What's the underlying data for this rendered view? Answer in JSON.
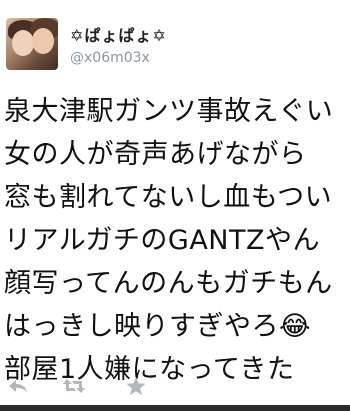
{
  "user": {
    "display_name": "✡ぱょぱょ✡",
    "handle": "@x06m03x"
  },
  "tweet": {
    "lines": [
      "泉大津駅ガンツ事故えぐい",
      "女の人が奇声あげながら",
      "窓も割れてないし血もつい",
      "リアルガチのGANTZやん",
      "顔写ってんのんもガチもん",
      "はっきし映りすぎやろ😂",
      "部屋1人嫌になってきた"
    ]
  },
  "actions": {
    "reply_icon": "reply-icon",
    "retweet_icon": "retweet-icon",
    "favorite_icon": "star-icon"
  },
  "colors": {
    "handle": "#8899a6",
    "action_icon": "#b0b8c0",
    "text": "#111111"
  }
}
